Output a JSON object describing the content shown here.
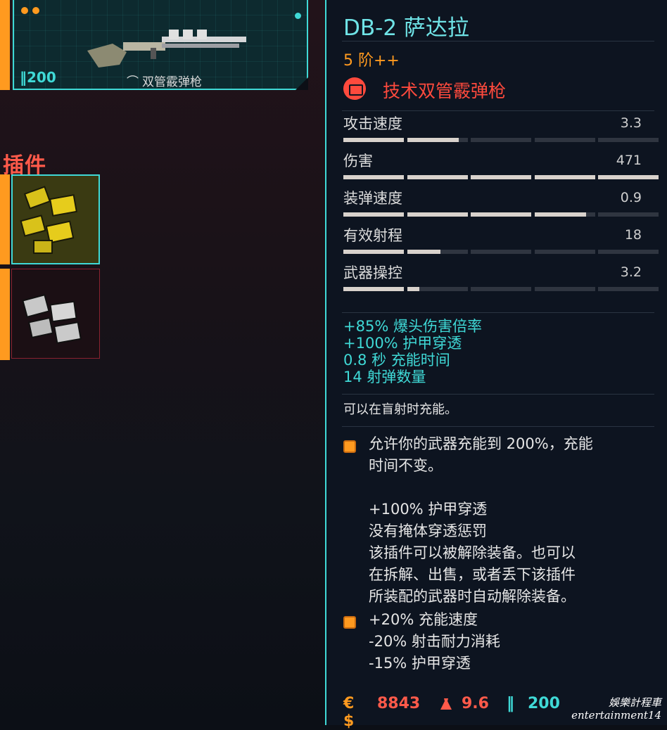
{
  "weapon_card": {
    "price": "200",
    "price_icon": "ammo-icon",
    "type": "双管霰弹枪",
    "type_icon": "shotgun-icon"
  },
  "mods_section": {
    "title": "插件"
  },
  "tooltip": {
    "name": "DB-2 萨达拉",
    "tier": "5 阶++",
    "class": "技术双管霰弹枪",
    "class_icon": "tech-weapon-icon",
    "stats": [
      {
        "name": "攻击速度",
        "value": "3.3",
        "fill": 0.37
      },
      {
        "name": "伤害",
        "value": "471",
        "fill": 1.0
      },
      {
        "name": "装弹速度",
        "value": "0.9",
        "fill": 0.77
      },
      {
        "name": "有效射程",
        "value": "18",
        "fill": 0.31
      },
      {
        "name": "武器操控",
        "value": "3.2",
        "fill": 0.24
      }
    ],
    "bonuses": [
      "+85% 爆头伤害倍率",
      "+100% 护甲穿透",
      "0.8 秒 充能时间",
      "14 射弹数量"
    ],
    "ability": "可以在盲射时充能。",
    "mods": [
      {
        "lines": [
          "允许你的武器充能到 200%，充能",
          "时间不变。",
          "",
          "+100% 护甲穿透",
          "没有掩体穿透惩罚",
          "该插件可以被解除装备。也可以",
          "在拆解、出售，或者丢下该插件",
          "所装配的武器时自动解除装备。"
        ]
      },
      {
        "lines": [
          "+20% 充能速度",
          "-20% 射击耐力消耗",
          "-15% 护甲穿透"
        ]
      }
    ],
    "footer": {
      "currency": "€$",
      "price": "8843",
      "weight_icon": "weight-icon",
      "weight": "9.6",
      "sell_icon": "ammo-icon",
      "sell_value": "200"
    }
  },
  "watermark": {
    "line1": "娛樂計程車",
    "line2": "entertainment14"
  },
  "colors": {
    "cyan": "#3fd9d6",
    "orange": "#ff9a1f",
    "red": "#ff4a3d",
    "panel_bg": "#0d1420"
  }
}
